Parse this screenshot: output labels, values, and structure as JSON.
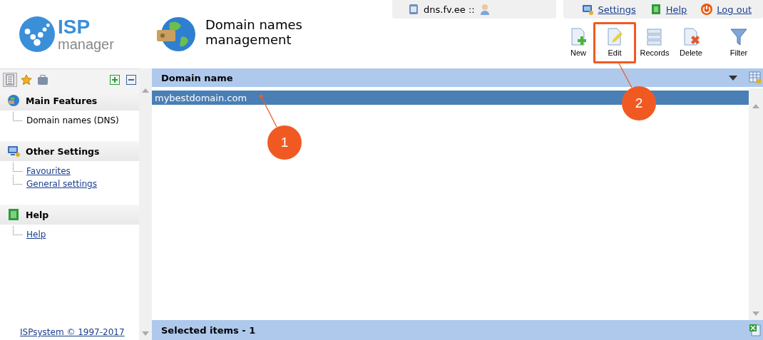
{
  "logo": {
    "brand": "ISP",
    "product": "manager"
  },
  "page_title": "Domain names management",
  "top_bar": {
    "server": "dns.fv.ee ::",
    "links": [
      {
        "label": "Settings",
        "kind": "settings"
      },
      {
        "label": "Help",
        "kind": "help"
      },
      {
        "label": "Log out",
        "kind": "logout"
      }
    ]
  },
  "toolbar": [
    {
      "label": "New",
      "kind": "new",
      "highlighted": false
    },
    {
      "label": "Edit",
      "kind": "edit",
      "highlighted": true
    },
    {
      "label": "Records",
      "kind": "records",
      "highlighted": false
    },
    {
      "label": "Delete",
      "kind": "delete",
      "highlighted": false
    },
    {
      "label": "Filter",
      "kind": "filter",
      "highlighted": false
    }
  ],
  "sidebar": {
    "tabs": [
      {
        "kind": "list",
        "selected": true
      },
      {
        "kind": "star",
        "selected": false
      },
      {
        "kind": "briefcase",
        "selected": false
      }
    ],
    "groups": [
      {
        "title": "Main Features",
        "kind": "globe",
        "items": [
          {
            "label": "Domain names (DNS)",
            "selected": true
          }
        ]
      },
      {
        "title": "Other Settings",
        "kind": "monitor",
        "items": [
          {
            "label": "Favourites",
            "selected": false
          },
          {
            "label": "General settings",
            "selected": false
          }
        ]
      },
      {
        "title": "Help",
        "kind": "help",
        "items": [
          {
            "label": "Help",
            "selected": false
          }
        ]
      }
    ],
    "copyright": "ISPsystem © 1997-2017"
  },
  "table": {
    "columns": [
      "Domain name"
    ],
    "rows": [
      {
        "cells": [
          "mybestdomain.com"
        ],
        "selected": true
      }
    ],
    "footer": "Selected items - 1"
  },
  "annotations": [
    {
      "label": "1"
    },
    {
      "label": "2"
    }
  ]
}
